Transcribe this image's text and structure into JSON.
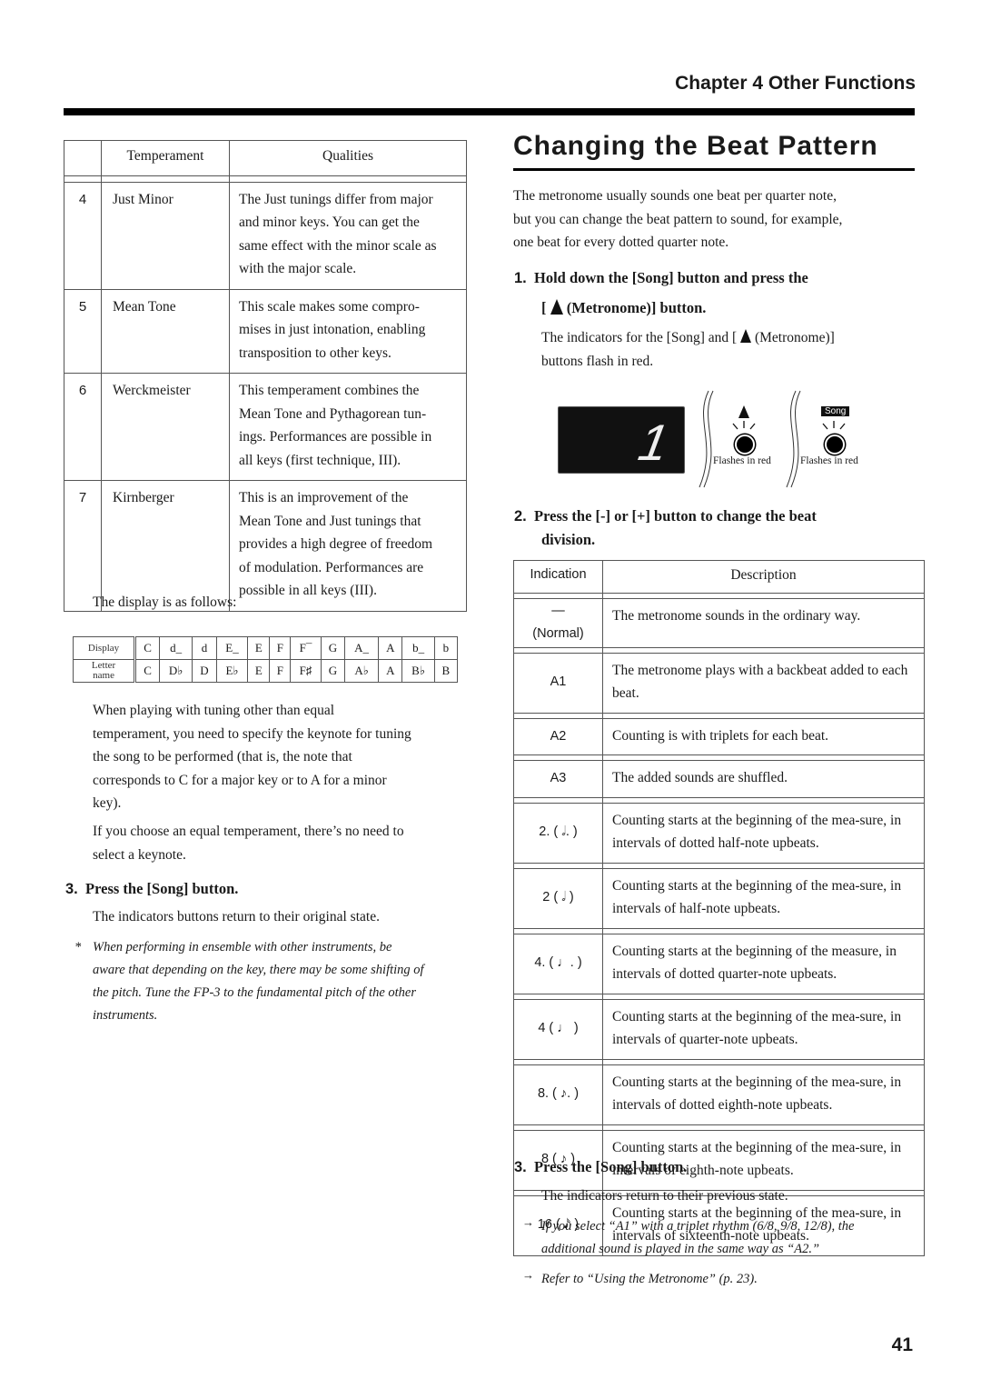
{
  "header": {
    "chapter": "Chapter 4 Other Functions"
  },
  "left": {
    "temperament_table": {
      "headers": [
        "",
        "Temperament",
        "Qualities"
      ],
      "rows": [
        {
          "num": "4",
          "name": "Just Minor",
          "lines": [
            "The Just tunings differ from major",
            "and minor keys. You can get the",
            "same effect with the minor scale as",
            "with the major scale."
          ]
        },
        {
          "num": "5",
          "name": "Mean Tone",
          "lines": [
            "This scale makes some compro-",
            "mises in just intonation, enabling",
            "transposition to other keys."
          ]
        },
        {
          "num": "6",
          "name": "Werckmeister",
          "lines": [
            "This temperament combines the",
            "Mean Tone and Pythagorean tun-",
            "ings. Performances are possible in",
            "all keys (first technique, III)."
          ]
        },
        {
          "num": "7",
          "name": "Kirnberger",
          "lines": [
            "This is an improvement of the",
            "Mean Tone and Just tunings that",
            "provides a high degree of freedom",
            "of modulation. Performances are",
            "possible in all keys (III)."
          ]
        }
      ]
    },
    "display_intro": "The display is as follows:",
    "display_table": {
      "display_label": "Display",
      "letter_label_1": "Letter",
      "letter_label_2": "name",
      "display": [
        "C",
        "d_",
        "d",
        "E_",
        "E",
        "F",
        "F¯",
        "G",
        "A_",
        "A",
        "b_",
        "b"
      ],
      "letter": [
        "C",
        "D♭",
        "D",
        "E♭",
        "E",
        "F",
        "F♯",
        "G",
        "A♭",
        "A",
        "B♭",
        "B"
      ]
    },
    "para1": [
      "When playing with tuning other than equal",
      "temperament, you need to specify the keynote for tuning",
      "the song to be performed (that is, the note that",
      "corresponds to C for a major key or to A for a minor",
      "key)."
    ],
    "para2": [
      "If you choose an equal temperament, there’s no need to",
      "select a keynote."
    ],
    "step3": {
      "num": "3.",
      "title": "Press the [Song] button."
    },
    "step3_text": "The indicators buttons return to their original state.",
    "note_mark": "*",
    "note": [
      "When performing in ensemble with other instruments, be",
      "aware that depending on the key, there may be some shifting of",
      "the pitch. Tune the FP-3 to the fundamental pitch of the other",
      "instruments."
    ]
  },
  "right": {
    "title": "Changing the Beat Pattern",
    "intro": [
      "The metronome usually sounds one beat per quarter note,",
      "but you can change the beat pattern to sound, for example,",
      "one beat for every dotted quarter note."
    ],
    "step1": {
      "num": "1.",
      "line1": "Hold down the [Song] button and press the",
      "line2_pre": "[",
      "line2_post": "(Metronome)] button."
    },
    "step1_text_a": "The indicators for the [Song] and [",
    "step1_text_b": "(Metronome)]",
    "step1_text_c": "buttons flash in red.",
    "figure": {
      "display_value": "1",
      "song_label": "Song",
      "flash_label_1": "Flashes in red",
      "flash_label_2": "Flashes in red"
    },
    "step2": {
      "num": "2.",
      "line1": "Press the [-] or [+] button to change the beat",
      "line2": "division."
    },
    "beat_table": {
      "headers": [
        "Indication",
        "Description"
      ],
      "rows": [
        {
          "ind": "—",
          "ind2": "(Normal)",
          "desc": "The metronome sounds in the ordinary way."
        },
        {
          "ind": "A1",
          "desc": "The metronome plays with a backbeat added to each beat."
        },
        {
          "ind": "A2",
          "desc": "Counting is with triplets for each beat."
        },
        {
          "ind": "A3",
          "desc": "The added sounds are shuffled."
        },
        {
          "ind": "2. ( 𝅗𝅥. )",
          "desc": "Counting starts at the beginning of the mea-sure, in intervals of dotted half-note upbeats."
        },
        {
          "ind": "2 ( 𝅗𝅥 )",
          "desc": "Counting starts at the beginning of the mea-sure, in intervals of half-note upbeats."
        },
        {
          "ind": "4. ( ♩. )",
          "desc": "Counting starts at the beginning of the measure, in intervals of dotted quarter-note upbeats."
        },
        {
          "ind": "4 ( ♩ )",
          "desc": "Counting starts at the beginning of the mea-sure, in intervals of quarter-note upbeats."
        },
        {
          "ind": "8. ( ♪. )",
          "desc": "Counting starts at the beginning of the mea-sure, in intervals of dotted eighth-note upbeats."
        },
        {
          "ind": "8 ( ♪ )",
          "desc": "Counting starts at the beginning of the mea-sure, in intervals of eighth-note upbeats."
        },
        {
          "ind": "16 ( 𝅘𝅥𝅯 )",
          "desc": "Counting starts at the beginning of the mea-sure, in intervals of sixteenth-note upbeats."
        }
      ]
    },
    "step3": {
      "num": "3.",
      "title": "Press the [Song] button."
    },
    "step3_text": "The indicators return to their previous state.",
    "arrow": "→",
    "note1": [
      "If you select “A1” with a triplet rhythm (6/8, 9/8, 12/8), the",
      "additional sound is played in the same way as “A2.”"
    ],
    "note2": "Refer to “Using the Metronome” (p. 23)."
  },
  "page_number": "41"
}
